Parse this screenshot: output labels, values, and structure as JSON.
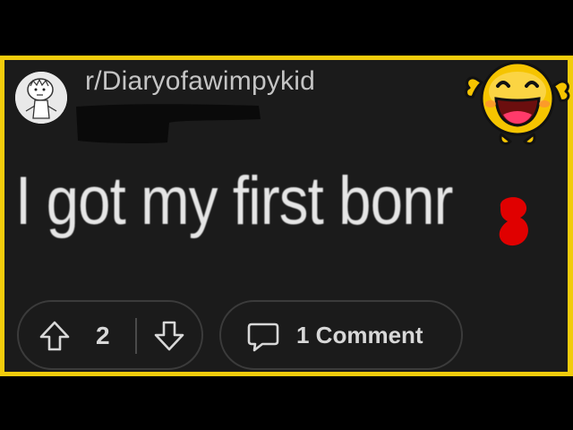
{
  "post": {
    "subreddit": "r/Diaryofawimpykid",
    "title": "I got my first bonr"
  },
  "actions": {
    "vote_count": "2",
    "comment_label": "1 Comment"
  },
  "icons": {
    "avatar": "diary-of-a-wimpy-kid-character-avatar",
    "upvote": "arrow-up-icon",
    "downvote": "arrow-down-icon",
    "comment": "speech-bubble-icon",
    "emoji": "laughing-emoji-icon"
  },
  "colors": {
    "frame": "#f2cc0c",
    "background": "#1b1b1b",
    "redaction": "#e00000"
  }
}
